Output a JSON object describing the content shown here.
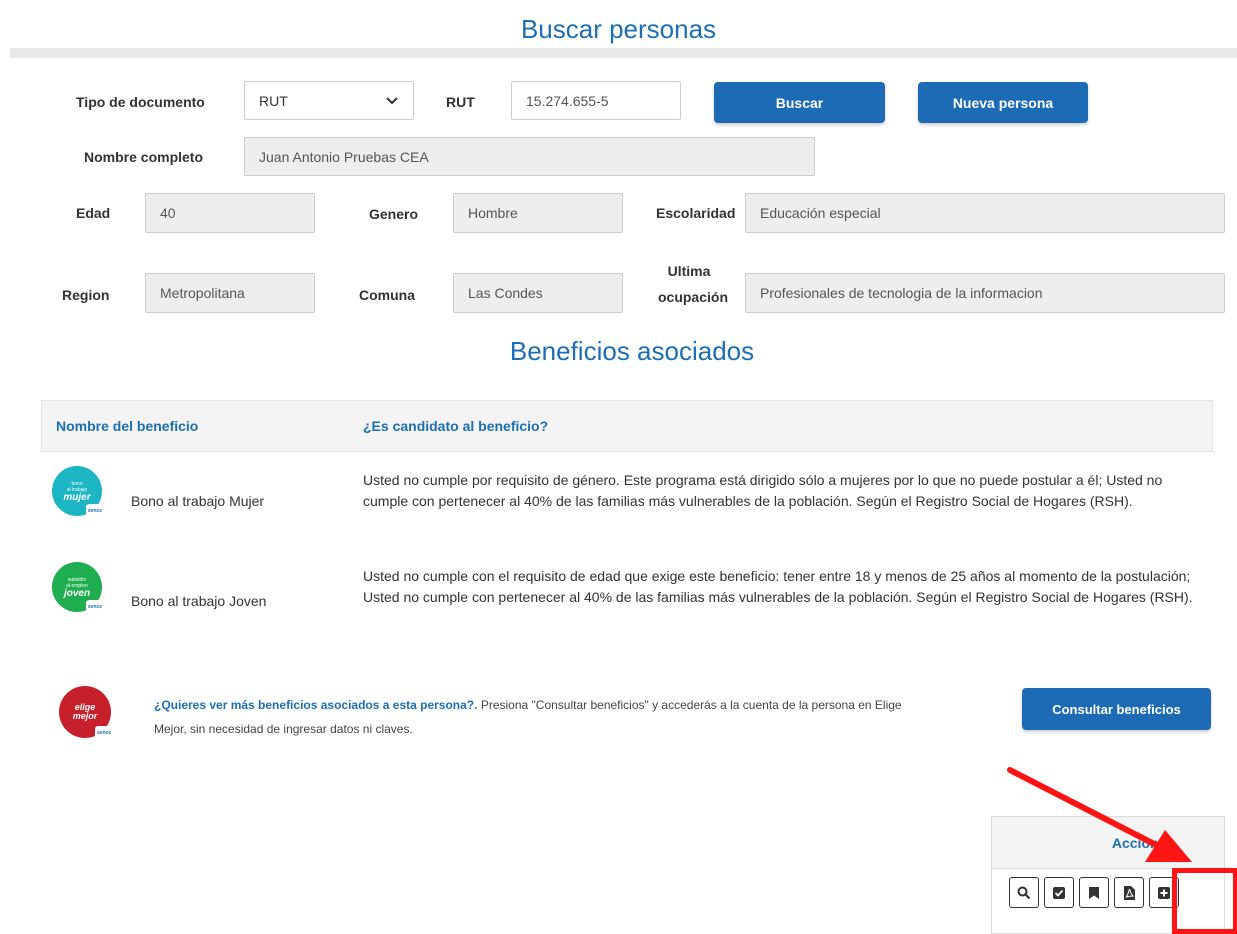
{
  "header": {
    "title": "Buscar personas"
  },
  "search": {
    "doc_type_label": "Tipo de documento",
    "doc_type_value": "RUT",
    "rut_label": "RUT",
    "rut_value": "15.274.655-5",
    "search_button": "Buscar",
    "new_person_button": "Nueva persona"
  },
  "person": {
    "full_name_label": "Nombre completo",
    "full_name_value": "Juan Antonio Pruebas CEA",
    "age_label": "Edad",
    "age_value": "40",
    "gender_label": "Genero",
    "gender_value": "Hombre",
    "schooling_label": "Escolaridad",
    "schooling_value": "Educación especial",
    "region_label": "Region",
    "region_value": "Metropolitana",
    "commune_label": "Comuna",
    "commune_value": "Las Condes",
    "last_job_label_line1": "Ultima",
    "last_job_label_line2": "ocupación",
    "last_job_value": "Profesionales de tecnologia de la informacion"
  },
  "benefits": {
    "title": "Beneficios asociados",
    "col_name": "Nombre del beneficio",
    "col_candidate": "¿Es candidato al beneficio?",
    "rows": [
      {
        "name": "Bono al trabajo Mujer",
        "description": "Usted no cumple por requisito de género. Este programa está dirigido sólo a mujeres por lo que no puede postular a él; Usted no cumple con pertenecer al 40% de las familias más vulnerables de la población. Según el Registro Social de Hogares (RSH).",
        "logo_line1": "bono",
        "logo_line2": "al trabajo",
        "logo_line3": "mujer",
        "logo_color": "#1bb5c4"
      },
      {
        "name": "Bono al trabajo Joven",
        "description": "Usted no cumple con el requisito de edad que exige este beneficio: tener entre 18 y menos de 25 años al momento de la postulación; Usted no cumple con pertenecer al 40% de las familias más vulnerables de la población. Según el Registro Social de Hogares (RSH).",
        "logo_line1": "subsidio",
        "logo_line2": "al empleo",
        "logo_line3": "joven",
        "logo_color": "#1fae4f"
      }
    ]
  },
  "promo": {
    "question": "¿Quieres ver más beneficios asociados a esta persona?.",
    "text": " Presiona \"Consultar beneficios\" y accederás a la cuenta de la persona en Elige Mejor, sin necesidad de ingresar datos ni claves.",
    "button": "Consultar beneficios",
    "logo_line1": "elige",
    "logo_line2": "mejor",
    "logo_color": "#c8202a"
  },
  "actions": {
    "header": "Acciones",
    "buttons": [
      "search-icon",
      "check-icon",
      "bookmark-icon",
      "pdf-icon",
      "plus-icon"
    ]
  },
  "logo_badge": "sence"
}
